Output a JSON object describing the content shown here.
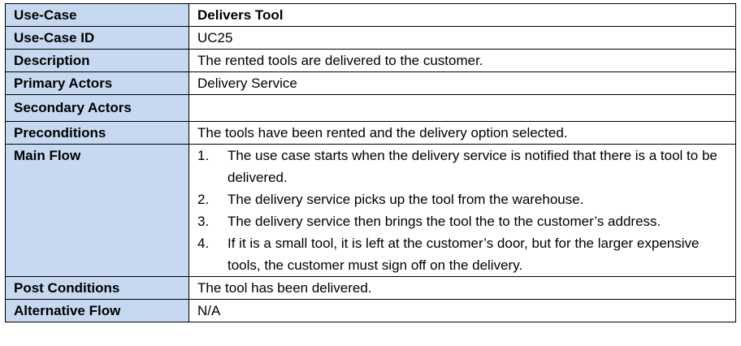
{
  "table": {
    "header": {
      "label": "Use-Case",
      "value": "Delivers Tool"
    },
    "rows": [
      {
        "label": "Use-Case ID",
        "value": "UC25"
      },
      {
        "label": "Description",
        "value": "The rented tools are delivered to the customer."
      },
      {
        "label": "Primary Actors",
        "value": "Delivery Service"
      },
      {
        "label": "Secondary Actors",
        "value": ""
      },
      {
        "label": "Preconditions",
        "value": "The tools have been rented and the delivery option selected."
      }
    ],
    "main_flow": {
      "label": "Main Flow",
      "steps": [
        {
          "num": "1.",
          "text": "The use case starts when the delivery service is notified that there is a tool to be delivered."
        },
        {
          "num": "2.",
          "text": "The delivery service picks up the tool from the warehouse."
        },
        {
          "num": "3.",
          "text": "The delivery service then brings the tool the to the customer’s address."
        },
        {
          "num": "4.",
          "text": "If it is a small tool, it is left at the customer’s door, but for the larger expensive tools, the customer must sign off on the delivery."
        }
      ]
    },
    "post_conditions": {
      "label": "Post Conditions",
      "value": "The tool has been delivered."
    },
    "alternative_flow": {
      "label": "Alternative Flow",
      "value": "N/A"
    }
  },
  "colors": {
    "label_bg": "#c6d9f1",
    "border": "#000000"
  }
}
